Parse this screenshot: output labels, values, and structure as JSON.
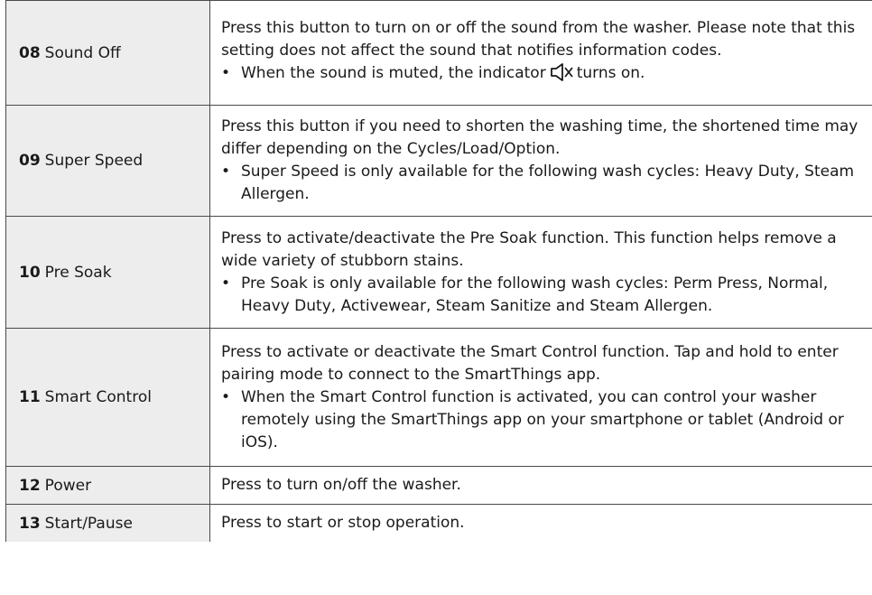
{
  "rows": [
    {
      "number": "08",
      "name": "Sound Off",
      "description": "Press this button to turn on or off the sound from the washer. Please note that this setting does not affect the sound that notifies information codes.",
      "bullet_before": "When the sound is muted, the indicator",
      "bullet_icon": "sound-mute-icon",
      "bullet_after": "turns on."
    },
    {
      "number": "09",
      "name": "Super Speed",
      "description": "Press this button if you need to shorten the washing time, the shortened time may differ depending on the Cycles/Load/Option.",
      "bullet": "Super Speed is only available for the following wash cycles: Heavy Duty, Steam Allergen."
    },
    {
      "number": "10",
      "name": "Pre Soak",
      "description": "Press to activate/deactivate the Pre Soak function. This function helps remove a wide variety of stubborn stains.",
      "bullet": "Pre Soak is only available for the following wash cycles: Perm Press, Normal, Heavy Duty, Activewear, Steam Sanitize and Steam Allergen."
    },
    {
      "number": "11",
      "name": "Smart Control",
      "description": "Press to activate or deactivate the Smart Control function. Tap and hold to enter pairing mode to connect to the SmartThings app.",
      "bullet": "When the Smart Control function is activated, you can control your washer remotely using the SmartThings app on your smartphone or tablet (Android or iOS)."
    },
    {
      "number": "12",
      "name": "Power",
      "description": "Press to turn on/off the washer."
    },
    {
      "number": "13",
      "name": "Start/Pause",
      "description": "Press to start or stop operation."
    }
  ],
  "bullet_symbol": "•"
}
